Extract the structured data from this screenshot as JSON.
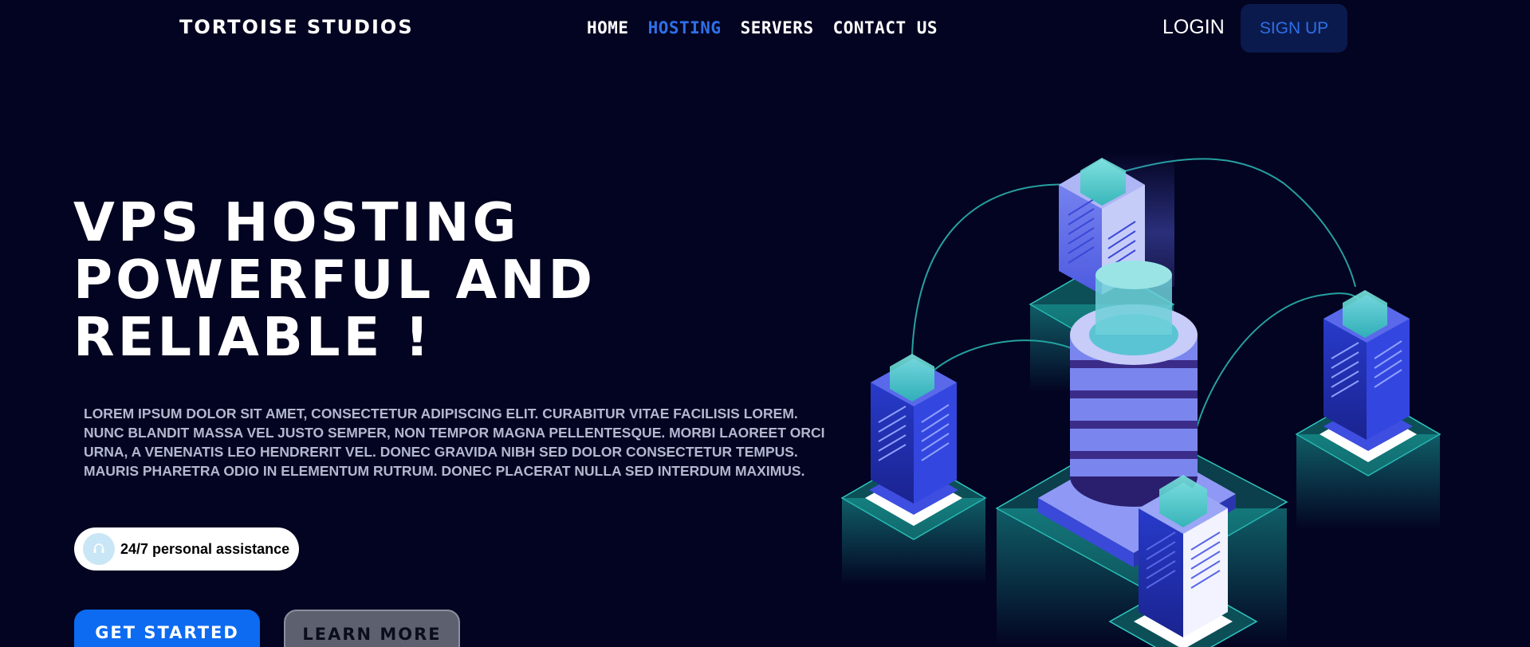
{
  "brand": "TORTOISE STUDIOS",
  "nav": {
    "items": [
      {
        "label": "HOME"
      },
      {
        "label": "HOSTING"
      },
      {
        "label": "SERVERS"
      },
      {
        "label": "CONTACT US"
      }
    ],
    "active": "HOSTING"
  },
  "auth": {
    "login_label": "LOGIN",
    "signup_label": "SIGN UP"
  },
  "hero": {
    "title_lines": [
      "VPS HOSTING",
      "POWERFUL AND",
      "RELIABLE !"
    ],
    "body": "LOREM IPSUM DOLOR SIT AMET, CONSECTETUR ADIPISCING ELIT. CURABITUR VITAE FACILISIS LOREM. NUNC BLANDIT MASSA VEL JUSTO SEMPER, NON TEMPOR MAGNA PELLENTESQUE. MORBI LAOREET ORCI URNA, A VENENATIS LEO HENDRERIT VEL. DONEC GRAVIDA NIBH SED DOLOR CONSECTETUR TEMPUS. MAURIS PHARETRA ODIO IN ELEMENTUM RUTRUM. DONEC PLACERAT NULLA SED INTERDUM MAXIMUS.",
    "assistance_label": "24/7 personal assistance",
    "assistance_icon": "headset-icon",
    "primary_cta": "GET STARTED",
    "secondary_cta": "LEARN MORE"
  },
  "colors": {
    "background": "#030421",
    "accent": "#2e6fe8",
    "primary_button": "#0c6bf0",
    "secondary_button": "#5d616f",
    "signup_bg": "#0b1a4d",
    "teal": "#2fc7c0"
  }
}
